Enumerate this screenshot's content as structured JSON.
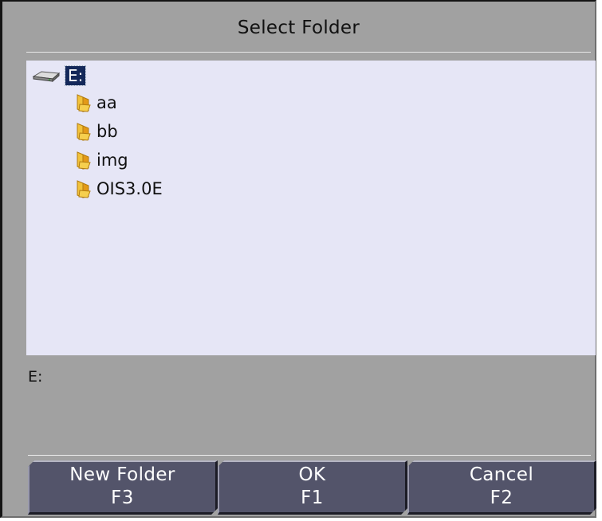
{
  "dialog": {
    "title": "Select Folder"
  },
  "tree": {
    "drive": {
      "label": "E:",
      "icon": "drive-icon",
      "selected": true
    },
    "folders": [
      {
        "label": "aa",
        "icon": "folder-icon"
      },
      {
        "label": "bb",
        "icon": "folder-icon"
      },
      {
        "label": "img",
        "icon": "folder-icon"
      },
      {
        "label": "OIS3.0E",
        "icon": "folder-icon"
      }
    ]
  },
  "selected_path": "E:",
  "buttons": {
    "new_folder": {
      "label": "New Folder",
      "key": "F3"
    },
    "ok": {
      "label": "OK",
      "key": "F1"
    },
    "cancel": {
      "label": "Cancel",
      "key": "F2"
    }
  },
  "colors": {
    "dialog_background": "#a1a1a1",
    "tree_background": "#e6e6f6",
    "selection": "#14285a",
    "button_face": "#53546a",
    "folder": "#e8b020"
  }
}
